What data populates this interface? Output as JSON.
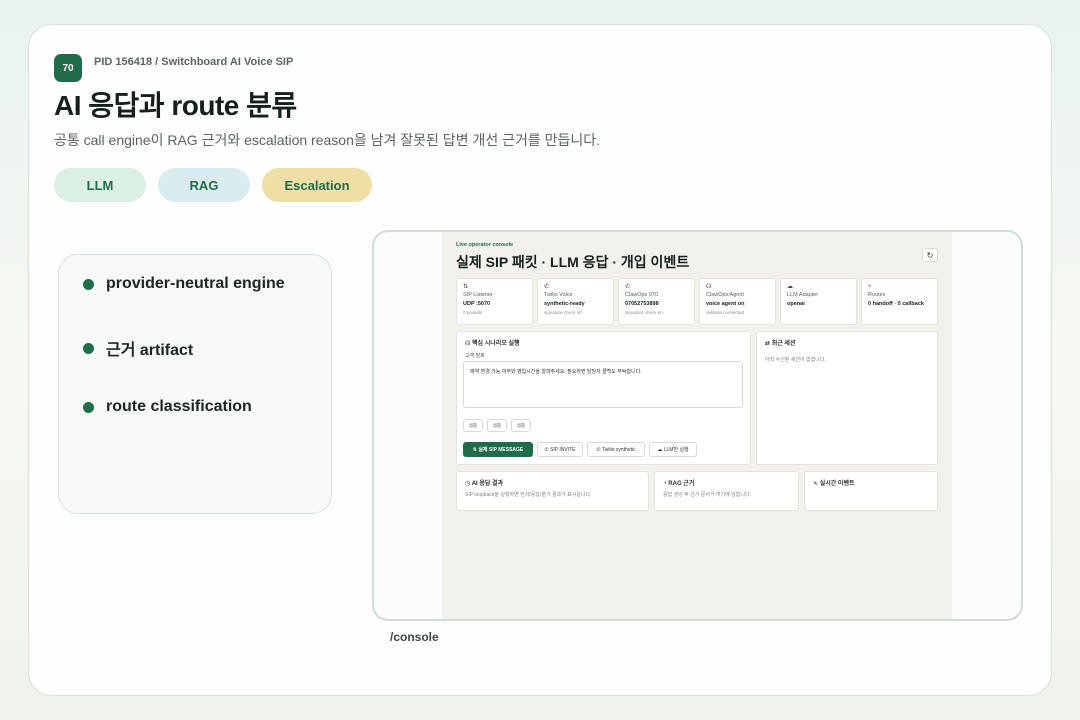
{
  "pid_badge": "70",
  "pid_text": "PID 156418 / Switchboard AI Voice SIP",
  "title": "AI 응답과 route 분류",
  "subtitle": "공통 call engine이 RAG 근거와 escalation reason을 남겨 잘못된 답변 개선 근거를 만듭니다.",
  "tags": {
    "llm": "LLM",
    "rag": "RAG",
    "escalation": "Escalation"
  },
  "features": [
    "provider-neutral engine",
    "근거 artifact",
    "route classification"
  ],
  "console_caption": "/console",
  "console": {
    "tag": "Live operator console",
    "title": "실제 SIP 패킷 · LLM 응답 · 개입 이벤트",
    "refresh_icon": "↻",
    "stats": [
      {
        "icon": "⇅",
        "label": "SIP Listener",
        "value": "UDP :5070",
        "sub": "0 packets"
      },
      {
        "icon": "✆",
        "label": "Twilio Voice",
        "value": "synthetic-ready",
        "sub": "signature check off"
      },
      {
        "icon": "✆",
        "label": "ClawOps 070",
        "value": "07052753898",
        "sub": "signature check on"
      },
      {
        "icon": "☊",
        "label": "ClawOps Agent",
        "value": "voice agent on",
        "sub": "realtime connected"
      },
      {
        "icon": "☁",
        "label": "LLM Adapter",
        "value": "openai",
        "sub": ""
      },
      {
        "icon": "⑂",
        "label": "Routes",
        "value": "0 handoff · 0 callback",
        "sub": ""
      }
    ],
    "scenario": {
      "title": "핵심 시나리오 실행",
      "utterance_label": "고객 발화",
      "utterance": "예약 변경 가능 여부와 영업시간을 알려주세요. 필요하면 담당자 콜백도 부탁합니다.",
      "chips": [
        "샘플",
        "샘플",
        "샘플"
      ],
      "buttons": {
        "sip_message": "실제 SIP MESSAGE",
        "sip_invite": "SIP INVITE",
        "twilio": "Twilio synthetic",
        "llm_only": "LLM만 실행"
      }
    },
    "recent": {
      "title": "최근 세션",
      "empty": "아직 수신된 세션이 없습니다."
    },
    "ai_result": {
      "title": "AI 응답 결과",
      "body": "SIP loopback을 실행하면 전사/응답/분기 결과가 표시됩니다."
    },
    "rag": {
      "title": "RAG 근거",
      "body": "응답 생성 후 근거 문서가 여기에 남습니다."
    },
    "events": {
      "title": "실시간 이벤트"
    }
  }
}
